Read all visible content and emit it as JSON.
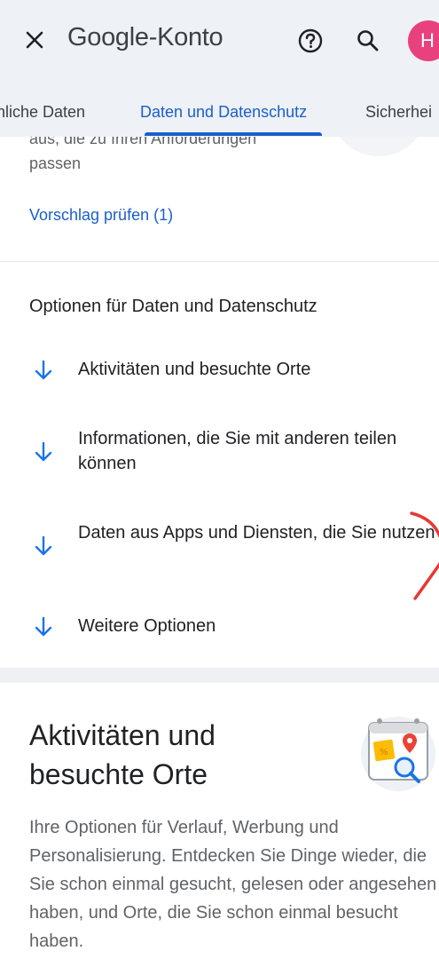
{
  "header": {
    "close_icon": "close-icon",
    "brand_google": "Google",
    "brand_suffix": "-Konto",
    "help_icon": "help-circle-icon",
    "search_icon": "search-icon",
    "avatar_letter": "H",
    "avatar_color": "#e8417e"
  },
  "tabs": [
    {
      "label": "nliche Daten"
    },
    {
      "label": "Daten und Datenschutz",
      "active": true
    },
    {
      "label": "Sicherhei"
    }
  ],
  "suggestion": {
    "partial_text_line1": "aus, die zu Ihren Anforderungen",
    "partial_text_line2": "passen",
    "link": "Vorschlag prüfen (1)"
  },
  "privacy_options": {
    "title": "Optionen für Daten und Datenschutz",
    "items": [
      {
        "label": "Aktivitäten und besuchte Orte",
        "icon": "arrow-down-icon"
      },
      {
        "label": "Informationen, die Sie mit anderen teilen können",
        "icon": "arrow-down-icon"
      },
      {
        "label": "Daten aus Apps und Diensten, die Sie nutzen",
        "icon": "arrow-down-icon"
      },
      {
        "label": "Weitere Optionen",
        "icon": "arrow-down-icon"
      }
    ]
  },
  "activity_section": {
    "title": "Aktivitäten und besuchte Orte",
    "body": "Ihre Optionen für Verlauf, Werbung und Personalisierung. Entdecken Sie Dinge wieder, die Sie schon einmal gesucht, gelesen oder angesehen haben, und Orte, die Sie schon einmal besucht haben.",
    "illustration": "calendar-map-search-illustration"
  },
  "colors": {
    "accent": "#1a5fcc",
    "header_bg": "#eef1f6",
    "text": "#202124",
    "muted": "#5f6368"
  }
}
